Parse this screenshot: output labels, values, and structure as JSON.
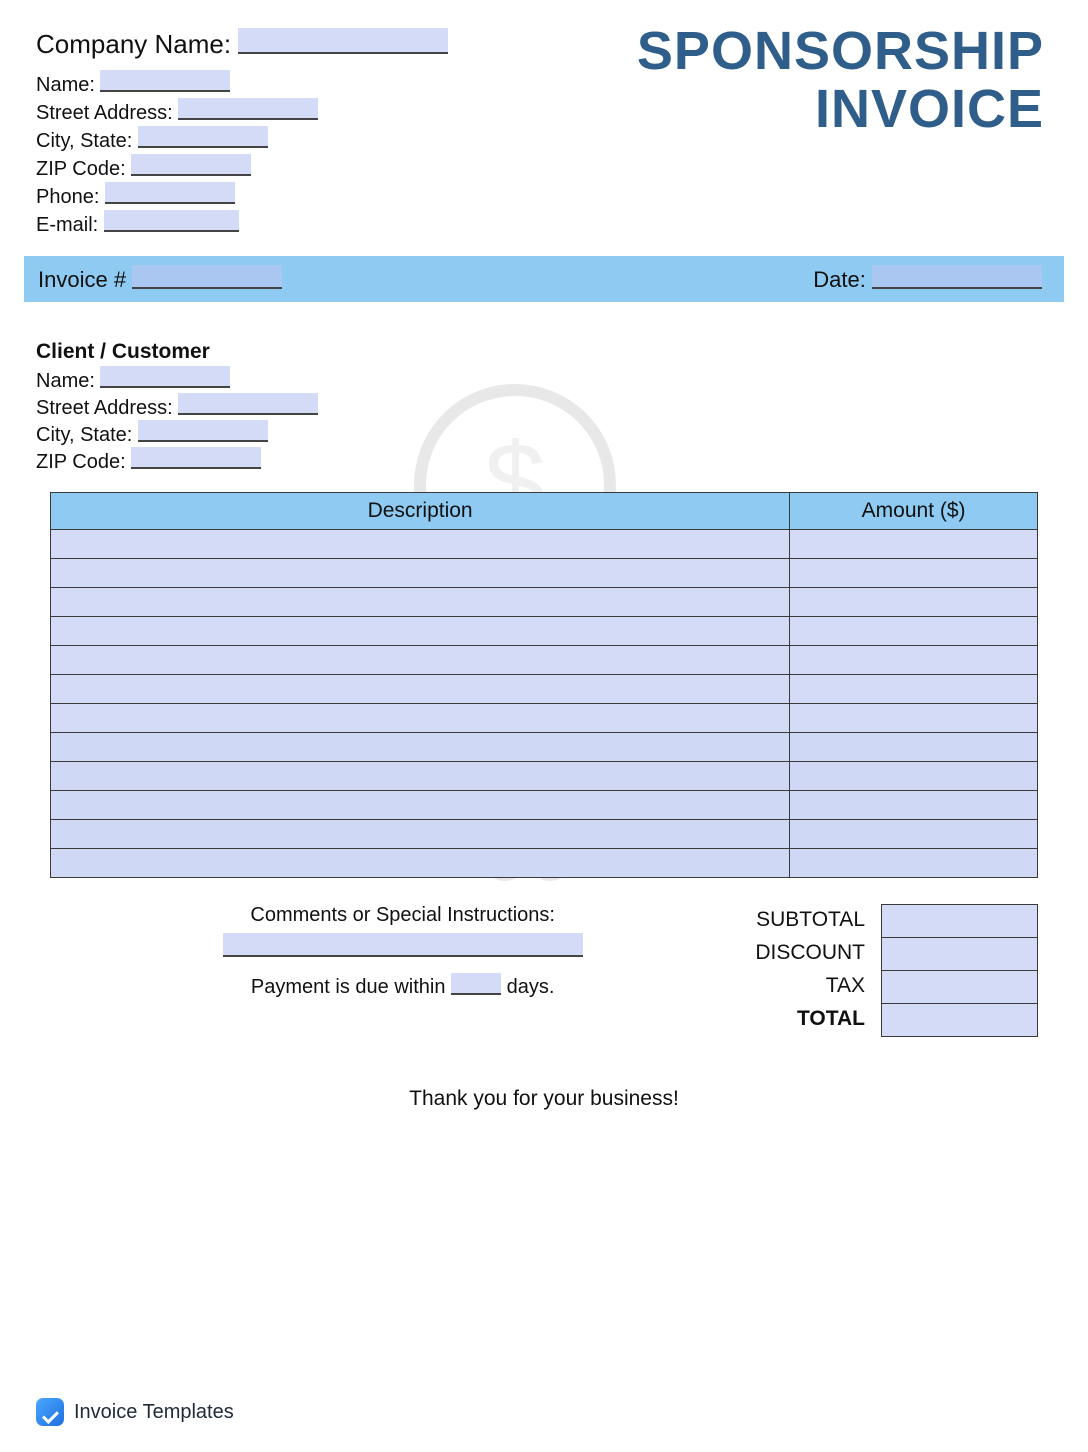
{
  "title_line1": "SPONSORSHIP",
  "title_line2": "INVOICE",
  "company": {
    "name_label": "Company Name:",
    "fields": {
      "name": "Name:",
      "street": "Street Address:",
      "city": "City, State:",
      "zip": "ZIP Code:",
      "phone": "Phone:",
      "email": "E-mail:"
    }
  },
  "bar": {
    "invoice_label": "Invoice #",
    "date_label": "Date:"
  },
  "client": {
    "heading": "Client / Customer",
    "fields": {
      "name": "Name:",
      "street": "Street Address:",
      "city": "City, State:",
      "zip": "ZIP Code:"
    }
  },
  "table": {
    "col_description": "Description",
    "col_amount": "Amount ($)",
    "rows": 12
  },
  "comments": {
    "label": "Comments or Special Instructions:",
    "due_prefix": "Payment is due within",
    "due_suffix": "days."
  },
  "totals": {
    "subtotal": "SUBTOTAL",
    "discount": "DISCOUNT",
    "tax": "TAX",
    "total": "TOTAL"
  },
  "thanks": "Thank you for your business!",
  "footer_brand": "Invoice Templates"
}
